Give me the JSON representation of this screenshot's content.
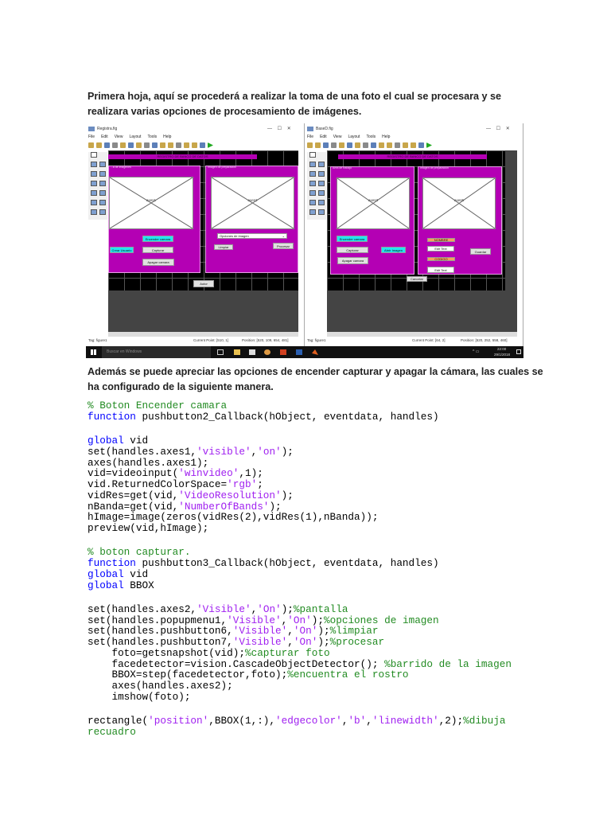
{
  "intro": {
    "lines": [
      "Primera hoja, aquí se procederá a realizar la toma de una foto el cual se procesara y se",
      "realizara varias opciones de procesamiento de imágenes."
    ]
  },
  "explain": {
    "lines": [
      "Además se puede apreciar las opciones de encender capturar y apagar la cámara, las cuales se",
      "ha configurado de la siguiente manera."
    ]
  },
  "menu": [
    "File",
    "Edit",
    "View",
    "Layout",
    "Tools",
    "Help"
  ],
  "window_left": {
    "title": "Registra.fig",
    "banner": "REGISTRO DE BANCO DE DATOS",
    "panel1_label": "...a de imagenes",
    "panel2_label": "Imagen de preparacion",
    "axes1": "axes1",
    "axes2": "axes2",
    "btn_encender": "Encender camara",
    "btn_crear": "Crear Usuario",
    "btn_capturar": "Capturar",
    "btn_apagar": "Apagar camara",
    "popup": "Opciones de imagen",
    "btn_limpiar": "Limpiar",
    "btn_procesar": "Procesar",
    "btn_autor": "Autor",
    "tag": "Tag: figure1",
    "current_point": "Current Point:  [510, 1]",
    "position": "Position: [520, 109, 654, 481]"
  },
  "window_right": {
    "title": "BaseD.fig",
    "banner": "REGISTRO DE BANCO DE DATOS",
    "panel1_label": "Area de trabajo",
    "panel2_label": "Imagen de preparacion",
    "axes1": "axes3",
    "axes2": "axes5",
    "btn_encender": "Encender camara",
    "btn_capturar": "Capturar",
    "btn_abrir": "Abrir Imagen",
    "btn_apagar": "Apagar camara",
    "label_nombre": "NOMBRE",
    "edit1": "Edit Text",
    "label_codigo": "CODIGO",
    "edit2": "Edit Text",
    "btn_guardar": "Guardar",
    "btn_cancelar": "Cancelar",
    "tag": "Tag: figure1",
    "current_point": "Current Point:  [64, 2]",
    "position": "Position: [520, 252, 558, 460]"
  },
  "taskbar": {
    "search_placeholder": "Buscar en Windows",
    "time": "22:00",
    "date": "29/1/2018"
  },
  "colors": {
    "keyword": "#0000ff",
    "string": "#a020f0",
    "comment": "#228b22",
    "gui_panel": "#b400b4",
    "gui_button_cyan": "#22e6f0",
    "gui_label_orange": "#f5a060"
  },
  "code": [
    [
      [
        "cm",
        "% Boton Encender camara"
      ]
    ],
    [
      [
        "kw",
        "function"
      ],
      [
        "tx",
        " pushbutton2_Callback(hObject, eventdata, handles)"
      ]
    ],
    [],
    [
      [
        "kw",
        "global"
      ],
      [
        "tx",
        " vid"
      ]
    ],
    [
      [
        "tx",
        "set(handles.axes1,"
      ],
      [
        "st",
        "'visible'"
      ],
      [
        "tx",
        ","
      ],
      [
        "st",
        "'on'"
      ],
      [
        "tx",
        ");"
      ]
    ],
    [
      [
        "tx",
        "axes(handles.axes1);"
      ]
    ],
    [
      [
        "tx",
        "vid=videoinput("
      ],
      [
        "st",
        "'winvideo'"
      ],
      [
        "tx",
        ",1);"
      ]
    ],
    [
      [
        "tx",
        "vid.ReturnedColorSpace="
      ],
      [
        "st",
        "'rgb'"
      ],
      [
        "tx",
        ";"
      ]
    ],
    [
      [
        "tx",
        "vidRes=get(vid,"
      ],
      [
        "st",
        "'VideoResolution'"
      ],
      [
        "tx",
        ");"
      ]
    ],
    [
      [
        "tx",
        "nBanda=get(vid,"
      ],
      [
        "st",
        "'NumberOfBands'"
      ],
      [
        "tx",
        ");"
      ]
    ],
    [
      [
        "tx",
        "hImage=image(zeros(vidRes(2),vidRes(1),nBanda));"
      ]
    ],
    [
      [
        "tx",
        "preview(vid,hImage);"
      ]
    ],
    [],
    [
      [
        "cm",
        "% boton capturar."
      ]
    ],
    [
      [
        "kw",
        "function"
      ],
      [
        "tx",
        " pushbutton3_Callback(hObject, eventdata, handles)"
      ]
    ],
    [
      [
        "kw",
        "global"
      ],
      [
        "tx",
        " vid"
      ]
    ],
    [
      [
        "kw",
        "global"
      ],
      [
        "tx",
        " BBOX"
      ]
    ],
    [],
    [
      [
        "tx",
        "set(handles.axes2,"
      ],
      [
        "st",
        "'Visible'"
      ],
      [
        "tx",
        ","
      ],
      [
        "st",
        "'On'"
      ],
      [
        "tx",
        ");"
      ],
      [
        "cm",
        "%pantalla"
      ]
    ],
    [
      [
        "tx",
        "set(handles.popupmenu1,"
      ],
      [
        "st",
        "'Visible'"
      ],
      [
        "tx",
        ","
      ],
      [
        "st",
        "'On'"
      ],
      [
        "tx",
        ");"
      ],
      [
        "cm",
        "%opciones de imagen"
      ]
    ],
    [
      [
        "tx",
        "set(handles.pushbutton6,"
      ],
      [
        "st",
        "'Visible'"
      ],
      [
        "tx",
        ","
      ],
      [
        "st",
        "'On'"
      ],
      [
        "tx",
        ");"
      ],
      [
        "cm",
        "%limpiar"
      ]
    ],
    [
      [
        "tx",
        "set(handles.pushbutton7,"
      ],
      [
        "st",
        "'Visible'"
      ],
      [
        "tx",
        ","
      ],
      [
        "st",
        "'On'"
      ],
      [
        "tx",
        ");"
      ],
      [
        "cm",
        "%procesar"
      ]
    ],
    [
      [
        "tx",
        "    foto=getsnapshot(vid);"
      ],
      [
        "cm",
        "%capturar foto"
      ]
    ],
    [
      [
        "tx",
        "    facedetector=vision.CascadeObjectDetector(); "
      ],
      [
        "cm",
        "%barrido de la imagen"
      ]
    ],
    [
      [
        "tx",
        "    BBOX=step(facedetector,foto);"
      ],
      [
        "cm",
        "%encuentra el rostro"
      ]
    ],
    [
      [
        "tx",
        "    axes(handles.axes2);"
      ]
    ],
    [
      [
        "tx",
        "    imshow(foto);"
      ]
    ],
    [],
    [
      [
        "tx",
        "rectangle("
      ],
      [
        "st",
        "'position'"
      ],
      [
        "tx",
        ",BBOX(1,:),"
      ],
      [
        "st",
        "'edgecolor'"
      ],
      [
        "tx",
        ","
      ],
      [
        "st",
        "'b'"
      ],
      [
        "tx",
        ","
      ],
      [
        "st",
        "'linewidth'"
      ],
      [
        "tx",
        ",2);"
      ],
      [
        "cm",
        "%dibuja"
      ]
    ],
    [
      [
        "cm",
        "recuadro"
      ]
    ]
  ]
}
